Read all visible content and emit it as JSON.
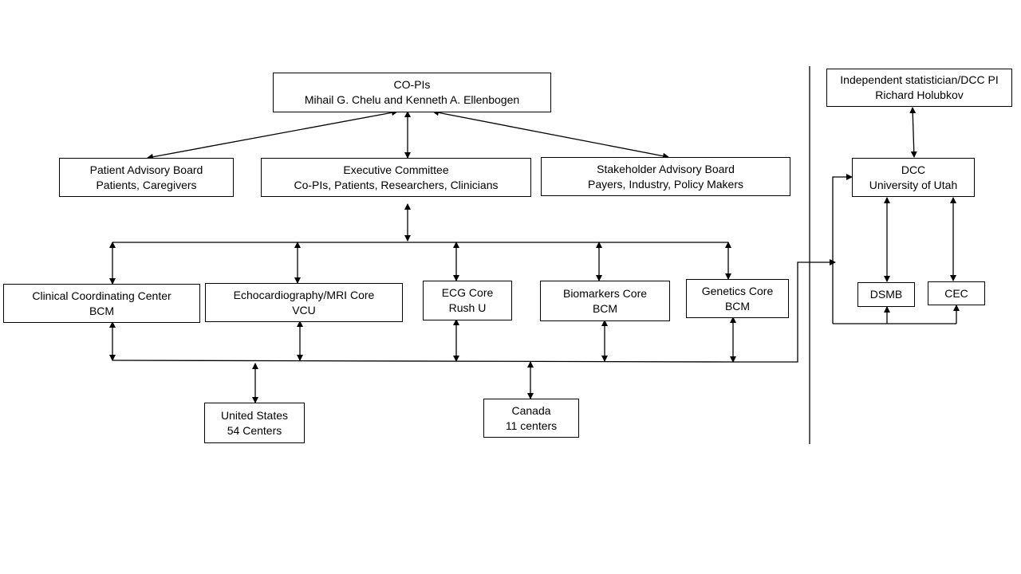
{
  "nodes": {
    "copis": {
      "title": "CO-PIs",
      "subtitle": "Mihail G. Chelu and Kenneth A. Ellenbogen"
    },
    "patient_board": {
      "title": "Patient Advisory Board",
      "subtitle": "Patients, Caregivers"
    },
    "executive": {
      "title": "Executive Committee",
      "subtitle": "Co-PIs, Patients, Researchers, Clinicians"
    },
    "stakeholder": {
      "title": "Stakeholder Advisory Board",
      "subtitle": "Payers, Industry, Policy Makers"
    },
    "clinical": {
      "title": "Clinical Coordinating Center",
      "subtitle": "BCM"
    },
    "echo": {
      "title": "Echocardiography/MRI Core",
      "subtitle": "VCU"
    },
    "ecg": {
      "title": "ECG Core",
      "subtitle": "Rush U"
    },
    "biomarkers": {
      "title": "Biomarkers Core",
      "subtitle": "BCM"
    },
    "genetics": {
      "title": "Genetics Core",
      "subtitle": "BCM"
    },
    "us": {
      "title": "United States",
      "subtitle": "54 Centers"
    },
    "canada": {
      "title": "Canada",
      "subtitle": "11 centers"
    },
    "statistician": {
      "title": "Independent statistician/DCC PI",
      "subtitle": "Richard Holubkov"
    },
    "dcc": {
      "title": "DCC",
      "subtitle": "University of Utah"
    },
    "dsmb": {
      "title": "DSMB"
    },
    "cec": {
      "title": "CEC"
    }
  }
}
